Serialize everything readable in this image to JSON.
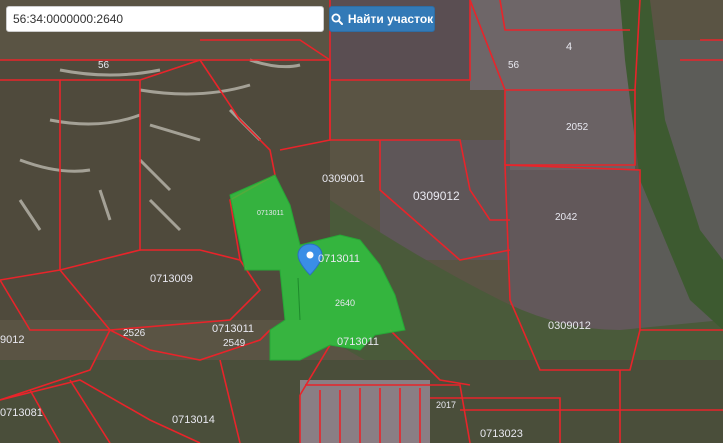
{
  "search": {
    "value": "56:34:0000000:2640",
    "button_label": "Найти участок"
  },
  "parcel_labels": {
    "n4": "4",
    "n56a": "56",
    "n56b": "56",
    "n2052": "2052",
    "n2042": "2042",
    "n0309001": "0309001",
    "n0309012a": "0309012",
    "n0309012b": "0309012",
    "n0713011a": "0713011",
    "n0713011b": "0713011",
    "n0713011c": "0713011",
    "n0713011d": "0713011",
    "n0713009": "0713009",
    "n2640": "2640",
    "n2526": "2526",
    "n2549": "2549",
    "n2017": "2017",
    "n0713014": "0713014",
    "n0713023": "0713023",
    "n0713081": "0713081",
    "n9012": "9012"
  },
  "colors": {
    "boundary": "#e8242a",
    "selected_fill": "#2ecc40",
    "marker": "#3a8ee6",
    "button": "#337ab7"
  }
}
